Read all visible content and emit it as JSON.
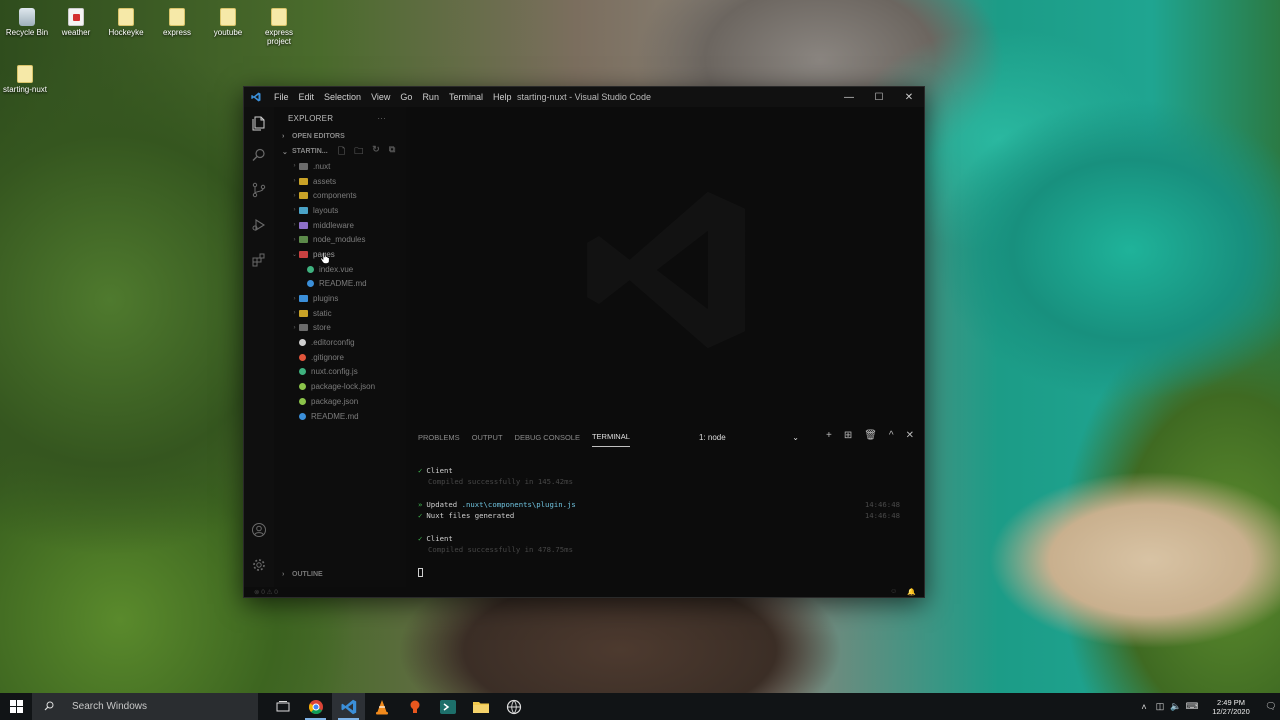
{
  "desktop": {
    "icons": [
      {
        "label": "Recycle Bin",
        "icon": "recycle-bin-icon"
      },
      {
        "label": "weather",
        "icon": "pdf-file-icon"
      },
      {
        "label": "Hockeyke",
        "icon": "folder-icon"
      },
      {
        "label": "express",
        "icon": "folder-icon"
      },
      {
        "label": "youtube",
        "icon": "folder-icon"
      },
      {
        "label": "express project",
        "icon": "folder-icon"
      },
      {
        "label": "starting-nuxt",
        "icon": "folder-icon"
      }
    ]
  },
  "window": {
    "title": "starting-nuxt - Visual Studio Code",
    "menu": [
      "File",
      "Edit",
      "Selection",
      "View",
      "Go",
      "Run",
      "Terminal",
      "Help"
    ],
    "controls": {
      "minimize": "—",
      "maximize": "☐",
      "close": "✕"
    }
  },
  "sidebar": {
    "title": "EXPLORER",
    "more": "···",
    "open_editors": "OPEN EDITORS",
    "project": "STARTIN...",
    "tree": [
      {
        "label": ".nuxt",
        "kind": "folder",
        "color": "#6b6b6b",
        "depth": 0,
        "chevron": "›"
      },
      {
        "label": "assets",
        "kind": "folder",
        "color": "#c9a227",
        "depth": 0,
        "chevron": "›"
      },
      {
        "label": "components",
        "kind": "folder",
        "color": "#c9a227",
        "depth": 0,
        "chevron": "›"
      },
      {
        "label": "layouts",
        "kind": "folder",
        "color": "#4aa3c7",
        "depth": 0,
        "chevron": "›"
      },
      {
        "label": "middleware",
        "kind": "folder",
        "color": "#8d6fc7",
        "depth": 0,
        "chevron": "›"
      },
      {
        "label": "node_modules",
        "kind": "folder",
        "color": "#5c8a4a",
        "depth": 0,
        "chevron": "›"
      },
      {
        "label": "pages",
        "kind": "folder",
        "color": "#c94040",
        "depth": 0,
        "chevron": "⌄"
      },
      {
        "label": "index.vue",
        "kind": "vue",
        "color": "#3fb27f",
        "depth": 1,
        "chevron": ""
      },
      {
        "label": "README.md",
        "kind": "info",
        "color": "#3b8fd9",
        "depth": 1,
        "chevron": ""
      },
      {
        "label": "plugins",
        "kind": "folder",
        "color": "#3b8fd9",
        "depth": 0,
        "chevron": "›"
      },
      {
        "label": "static",
        "kind": "folder",
        "color": "#c9a227",
        "depth": 0,
        "chevron": "›"
      },
      {
        "label": "store",
        "kind": "folder",
        "color": "#6b6b6b",
        "depth": 0,
        "chevron": "›"
      },
      {
        "label": ".editorconfig",
        "kind": "gear",
        "color": "#cfcfcf",
        "depth": 0,
        "chevron": ""
      },
      {
        "label": ".gitignore",
        "kind": "git",
        "color": "#e2553b",
        "depth": 0,
        "chevron": ""
      },
      {
        "label": "nuxt.config.js",
        "kind": "nuxt",
        "color": "#3fb27f",
        "depth": 0,
        "chevron": ""
      },
      {
        "label": "package-lock.json",
        "kind": "npm",
        "color": "#8bc34a",
        "depth": 0,
        "chevron": ""
      },
      {
        "label": "package.json",
        "kind": "npm",
        "color": "#8bc34a",
        "depth": 0,
        "chevron": ""
      },
      {
        "label": "README.md",
        "kind": "info",
        "color": "#3b8fd9",
        "depth": 0,
        "chevron": ""
      }
    ],
    "outline": "OUTLINE"
  },
  "panel": {
    "tabs": [
      "PROBLEMS",
      "OUTPUT",
      "DEBUG CONSOLE",
      "TERMINAL"
    ],
    "active_tab": "TERMINAL",
    "terminal_select": "1: node",
    "actions": [
      "+",
      "⊞",
      "🗑",
      "^",
      "✕"
    ]
  },
  "terminal": {
    "client1": "Client",
    "compiled1": "Compiled successfully in 145.42ms",
    "updated_prefix": "Updated",
    "updated_path": ".nuxt\\components\\plugin.js",
    "time1": "14:46:48",
    "generated": "Nuxt files generated",
    "time2": "14:46:48",
    "client2": "Client",
    "compiled2": "Compiled successfully in 478.75ms"
  },
  "statusbar": {
    "errors": "⊗ 0 ⚠ 0"
  },
  "taskbar": {
    "search_placeholder": "Search Windows",
    "clock_time": "2:49 PM",
    "clock_date": "12/27/2020"
  },
  "colors": {
    "vscode_blue": "#3b8fd9",
    "taskbar_indicator": "#7fb3e6"
  }
}
